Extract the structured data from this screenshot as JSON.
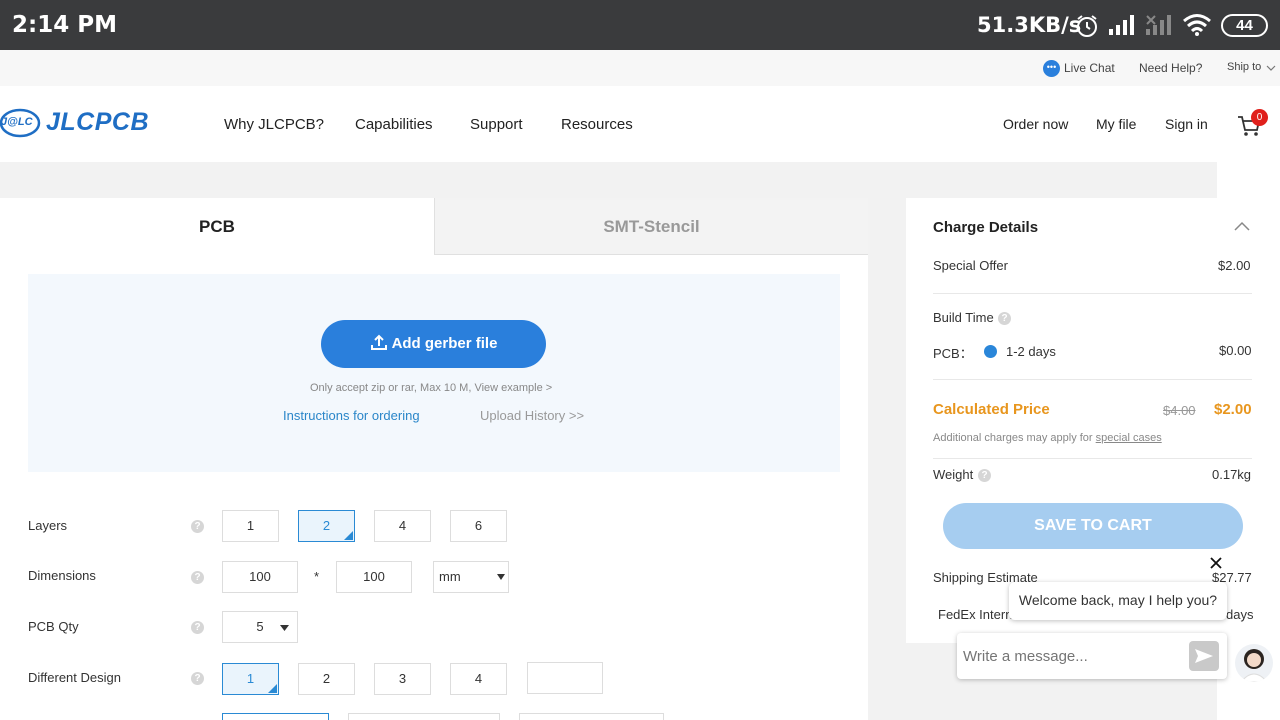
{
  "status_bar": {
    "time": "2:14 PM",
    "net_speed": "51.3KB/s",
    "battery": "44"
  },
  "util_bar": {
    "live_chat": "Live Chat",
    "need_help": "Need Help?",
    "ship_to": "Ship to"
  },
  "header": {
    "logo_badge": "J@LC",
    "logo_text": "JLCPCB",
    "nav": [
      "Why JLCPCB?",
      "Capabilities",
      "Support",
      "Resources"
    ],
    "order_now": "Order now",
    "my_file": "My file",
    "sign_in": "Sign in",
    "cart_count": "0"
  },
  "tabs": {
    "pcb": "PCB",
    "smt": "SMT-Stencil"
  },
  "upload": {
    "button_label": "Add gerber file",
    "note": "Only accept zip or rar, Max 10 M, View example >",
    "instructions": "Instructions for ordering",
    "history": "Upload History >>"
  },
  "form": {
    "layers": {
      "label": "Layers",
      "options": [
        "1",
        "2",
        "4",
        "6"
      ],
      "selected": "2"
    },
    "dimensions": {
      "label": "Dimensions",
      "width": "100",
      "times": "*",
      "height": "100",
      "unit": "mm"
    },
    "pcb_qty": {
      "label": "PCB Qty",
      "value": "5"
    },
    "different_design": {
      "label": "Different Design",
      "options": [
        "1",
        "2",
        "3",
        "4"
      ],
      "selected": "1",
      "custom": ""
    }
  },
  "charge": {
    "title": "Charge Details",
    "special_offer_label": "Special Offer",
    "special_offer_value": "$2.00",
    "build_time_label": "Build Time",
    "pcb_label": "PCB：",
    "pcb_days": "1-2 days",
    "pcb_price": "$0.00",
    "calc_label": "Calculated Price",
    "calc_old": "$4.00",
    "calc_new": "$2.00",
    "additional_note": "Additional charges may apply for ",
    "special_cases": "special cases",
    "weight_label": "Weight",
    "weight_value": "0.17kg",
    "save_button": "SAVE TO CART",
    "shipping_label": "Shipping Estimate",
    "shipping_value": "$27.77",
    "fedex_label": "FedEx Intern",
    "fedex_days": "days"
  },
  "chat": {
    "welcome": "Welcome back, may I help you?",
    "placeholder": "Write a message..."
  },
  "colors": {
    "brand_blue": "#1f6ec4",
    "primary_button": "#2a7fdc",
    "calc_price": "#e8961e",
    "cart_badge": "#e0201c"
  }
}
